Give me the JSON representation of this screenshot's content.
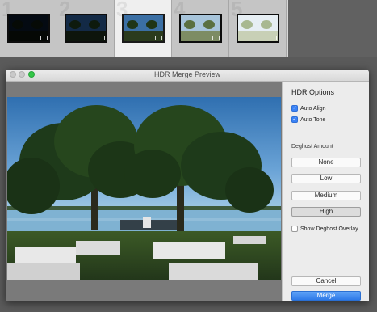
{
  "filmstrip": {
    "thumbnails": [
      {
        "number": "1",
        "tone": "very dark"
      },
      {
        "number": "2",
        "tone": "dark"
      },
      {
        "number": "3",
        "tone": "normal"
      },
      {
        "number": "4",
        "tone": "bright"
      },
      {
        "number": "5",
        "tone": "very bright"
      }
    ],
    "selected_index": 2
  },
  "window": {
    "title": "HDR Merge Preview"
  },
  "options": {
    "title": "HDR Options",
    "auto_align": {
      "label": "Auto Align",
      "checked": true
    },
    "auto_tone": {
      "label": "Auto Tone",
      "checked": true
    },
    "deghost_label": "Deghost Amount",
    "deghost_buttons": [
      "None",
      "Low",
      "Medium",
      "High"
    ],
    "deghost_selected": "High",
    "show_overlay": {
      "label": "Show Deghost Overlay",
      "checked": false
    },
    "cancel_label": "Cancel",
    "merge_label": "Merge"
  },
  "colors": {
    "accent": "#2f7ae8",
    "traffic_green": "#34c748"
  }
}
